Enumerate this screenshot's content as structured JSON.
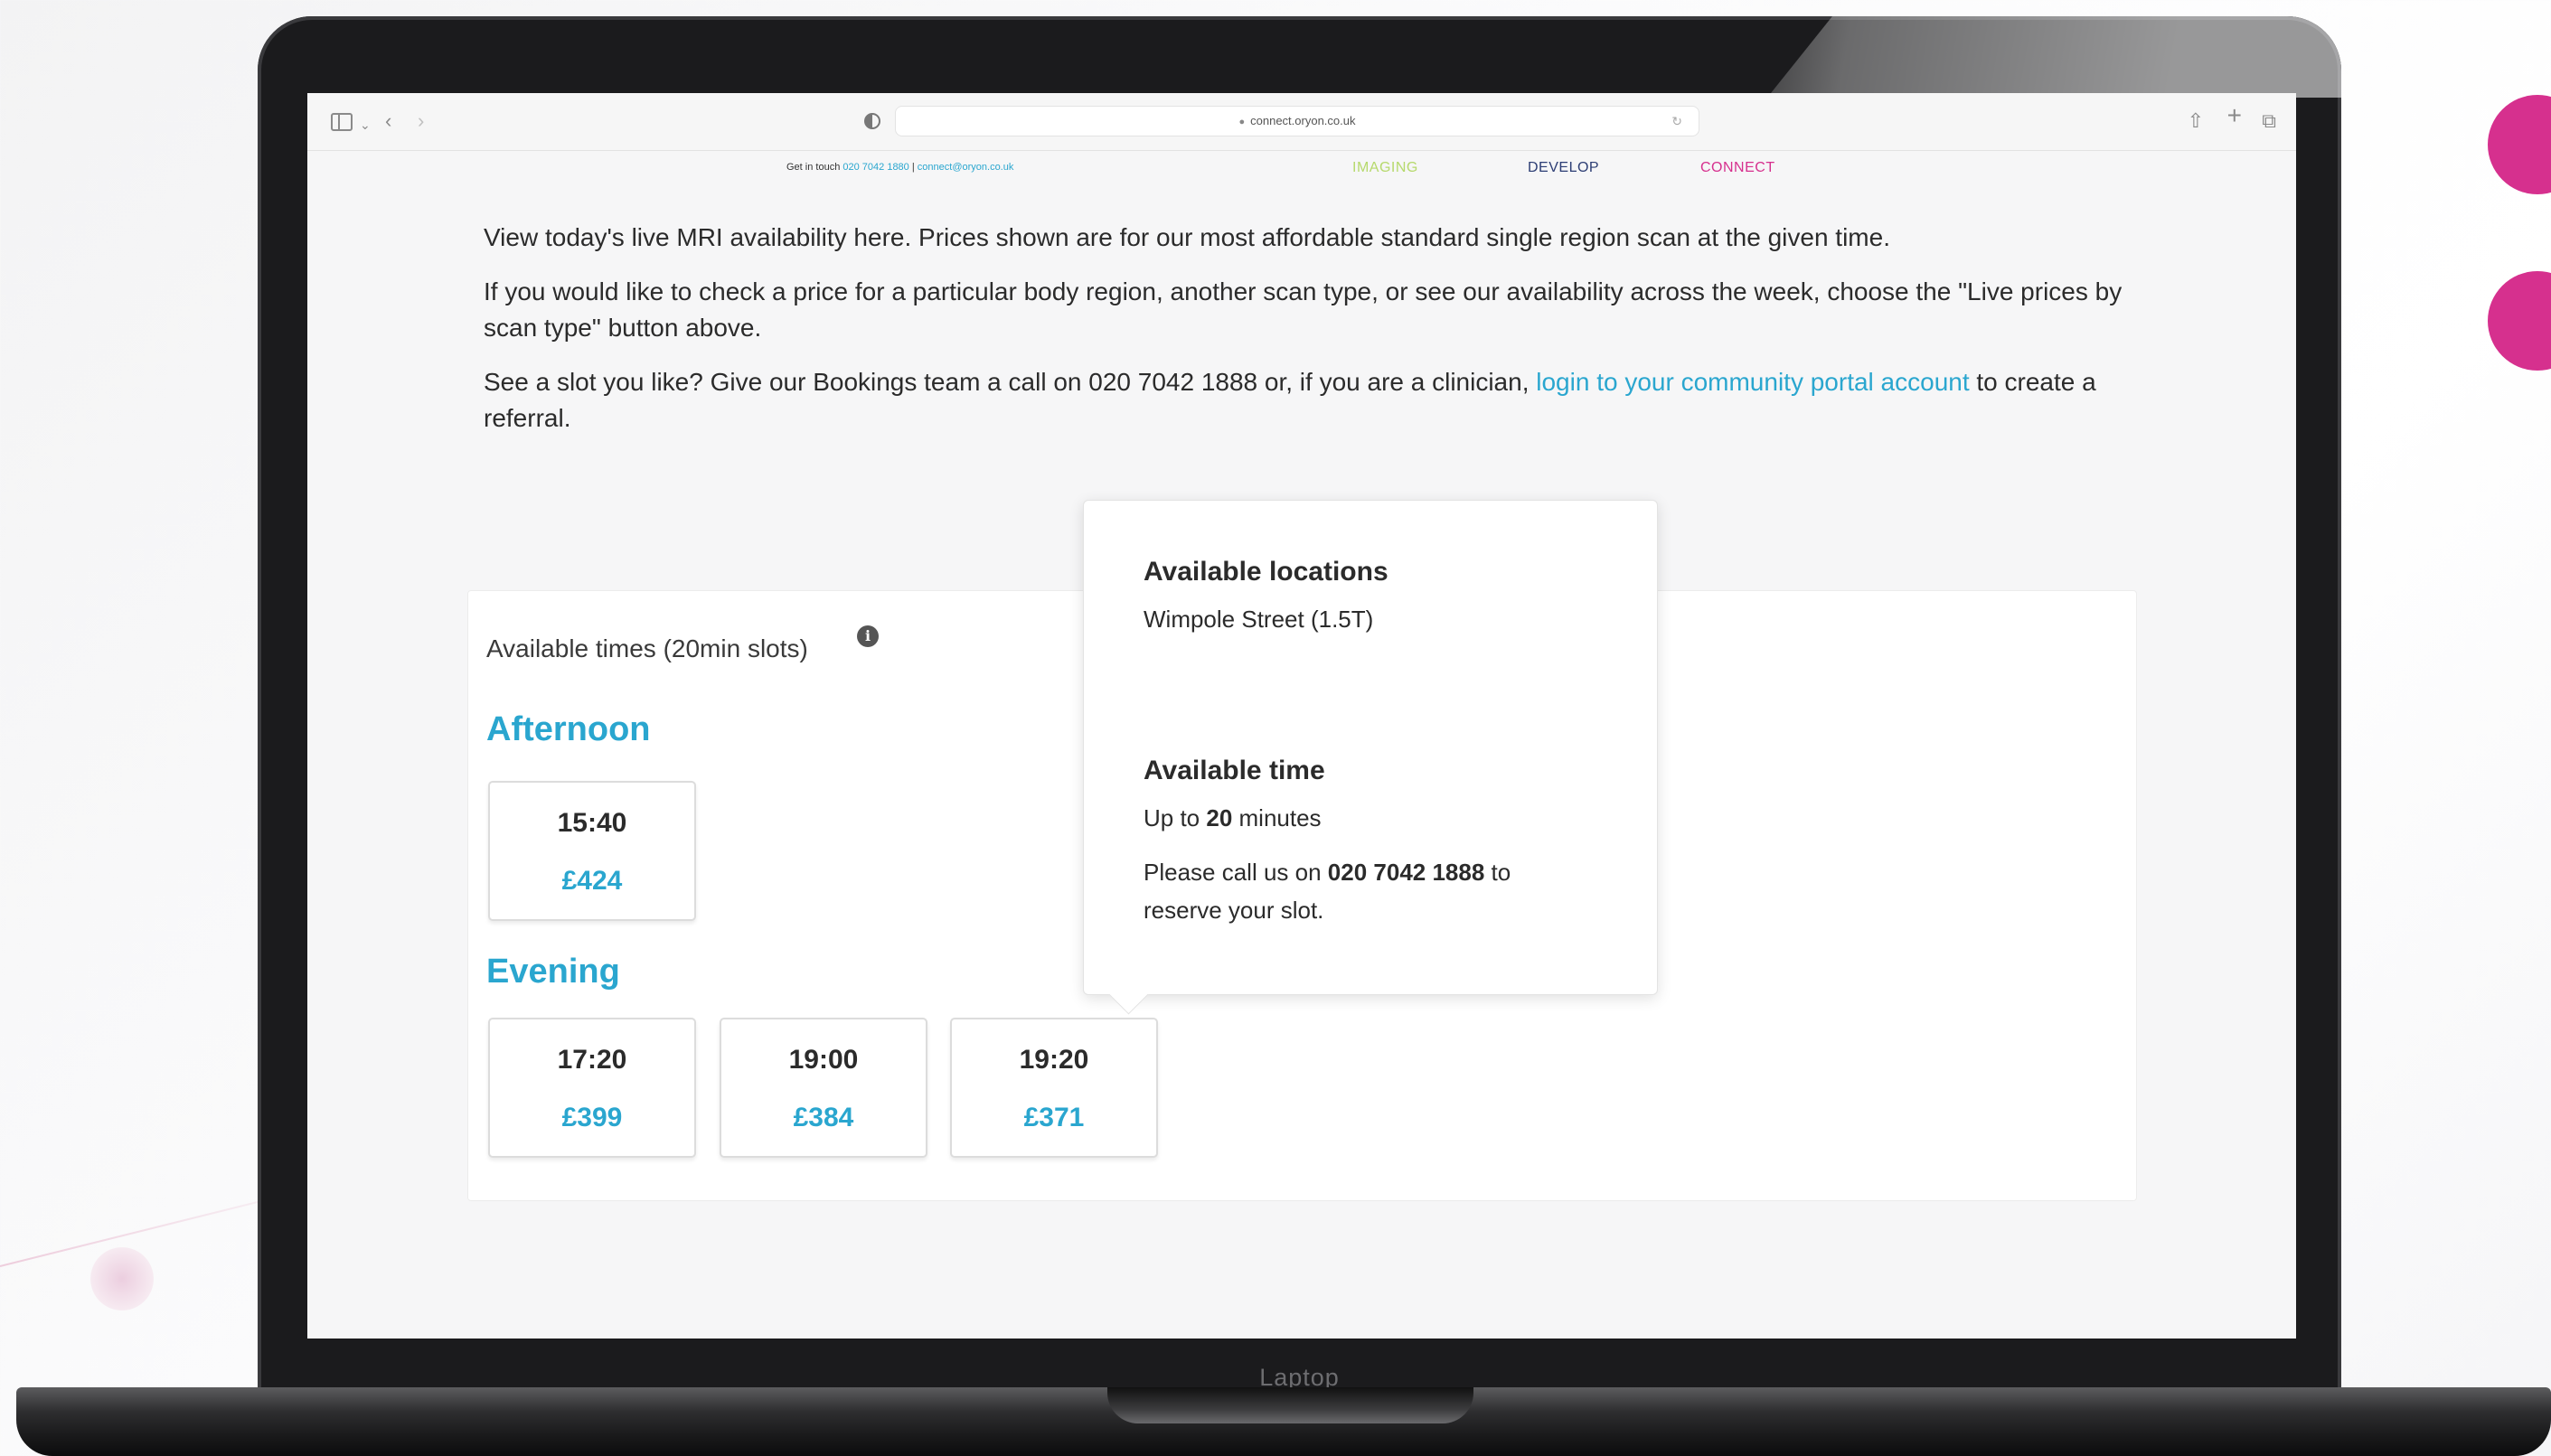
{
  "browser": {
    "url": "connect.oryon.co.uk"
  },
  "laptop_label": "Laptop",
  "site_nav": {
    "touch_label": "Get in touch",
    "touch_phone": "020 7042 1880",
    "touch_sep": " | ",
    "touch_email": "connect@oryon.co.uk",
    "links": [
      "IMAGING",
      "DEVELOP",
      "CONNECT"
    ]
  },
  "intro": {
    "p1": "View today's live MRI availability here. Prices shown are for our most affordable standard single region scan at the given time.",
    "p2": "If you would like to check a price for a particular body region, another scan type, or see our availability across the week, choose the \"Live prices by scan type\" button above.",
    "p3_before": "See a slot you like? Give our Bookings team a call on 020 7042 1888 or, if you are a clinician, ",
    "p3_link": "login to your community portal account",
    "p3_after": " to create a referral."
  },
  "availability": {
    "title": "Available times (20min slots)",
    "info_glyph": "i",
    "afternoon_label": "Afternoon",
    "evening_label": "Evening",
    "afternoon_slots": [
      {
        "time": "15:40",
        "price": "£424"
      }
    ],
    "evening_slots": [
      {
        "time": "17:20",
        "price": "£399"
      },
      {
        "time": "19:00",
        "price": "£384"
      },
      {
        "time": "19:20",
        "price": "£371"
      }
    ]
  },
  "popover": {
    "locations_heading": "Available locations",
    "location": "Wimpole Street (1.5T)",
    "time_heading": "Available time",
    "time_prefix": "Up to ",
    "time_value": "20",
    "time_suffix": " minutes",
    "call_prefix": "Please call us on ",
    "call_phone": "020 7042 1888",
    "call_suffix": " to reserve your slot."
  },
  "colors": {
    "accent": "#2aa6cf",
    "imaging": "#b6d96c",
    "develop": "#2c3d74",
    "connect": "#d6308e"
  }
}
